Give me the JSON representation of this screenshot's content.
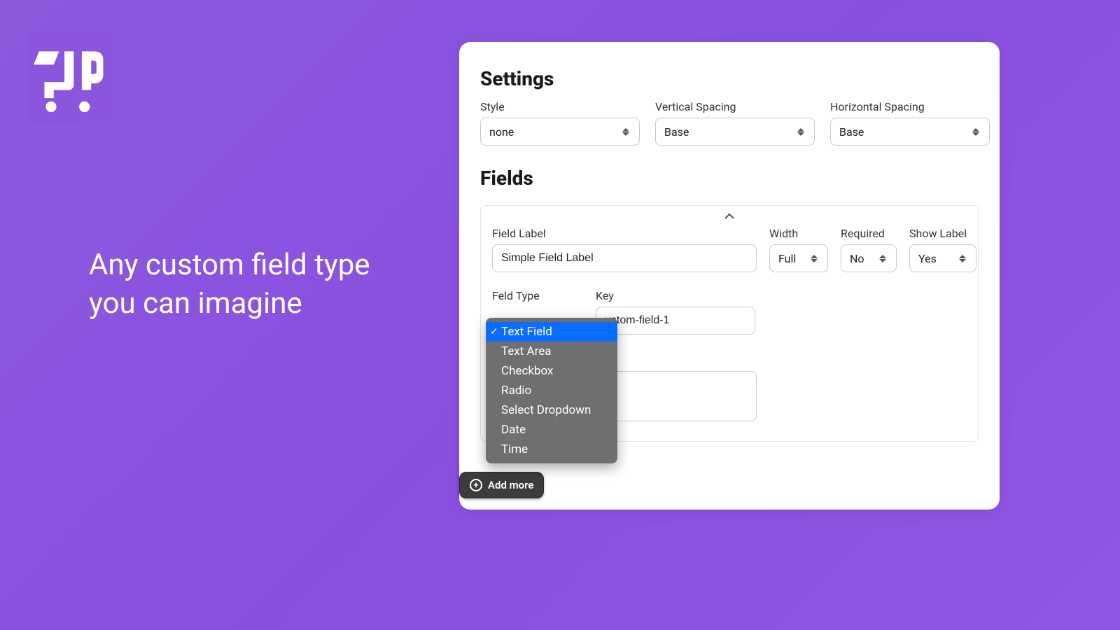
{
  "headline": "Any custom field type you can imagine",
  "settings": {
    "title": "Settings",
    "style_label": "Style",
    "style_value": "none",
    "vspace_label": "Vertical Spacing",
    "vspace_value": "Base",
    "hspace_label": "Horizontal Spacing",
    "hspace_value": "Base"
  },
  "fields": {
    "title": "Fields",
    "field_label_label": "Field Label",
    "field_label_value": "Simple Field Label",
    "width_label": "Width",
    "width_value": "Full",
    "required_label": "Required",
    "required_value": "No",
    "showlabel_label": "Show Label",
    "showlabel_value": "Yes",
    "field_type_label": "Feld Type",
    "key_label": "Key",
    "key_value": "ustom-field-1",
    "placeholder_value": ""
  },
  "dropdown": {
    "items": {
      "0": "Text Field",
      "1": "Text Area",
      "2": "Checkbox",
      "3": "Radio",
      "4": "Select Dropdown",
      "5": "Date",
      "6": "Time"
    }
  },
  "add_more_label": "Add more"
}
